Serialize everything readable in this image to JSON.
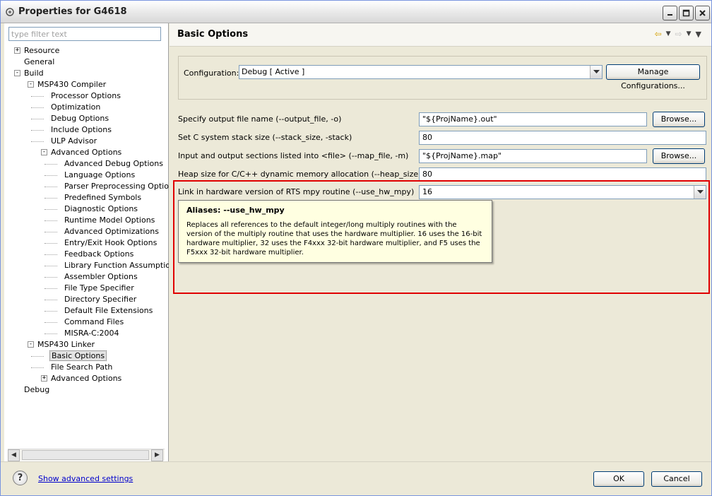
{
  "window": {
    "title": "Properties for G4618"
  },
  "left": {
    "filter_placeholder": "type filter text",
    "tree": [
      {
        "label": "Resource",
        "level": 0,
        "expander": "+"
      },
      {
        "label": "General",
        "level": 0
      },
      {
        "label": "Build",
        "level": 0,
        "expander": "-"
      },
      {
        "label": "MSP430 Compiler",
        "level": 1,
        "expander": "-"
      },
      {
        "label": "Processor Options",
        "level": 2
      },
      {
        "label": "Optimization",
        "level": 2
      },
      {
        "label": "Debug Options",
        "level": 2
      },
      {
        "label": "Include Options",
        "level": 2
      },
      {
        "label": "ULP Advisor",
        "level": 2
      },
      {
        "label": "Advanced Options",
        "level": 2,
        "expander": "-"
      },
      {
        "label": "Advanced Debug Options",
        "level": 3
      },
      {
        "label": "Language Options",
        "level": 3
      },
      {
        "label": "Parser Preprocessing Option",
        "level": 3
      },
      {
        "label": "Predefined Symbols",
        "level": 3
      },
      {
        "label": "Diagnostic Options",
        "level": 3
      },
      {
        "label": "Runtime Model Options",
        "level": 3
      },
      {
        "label": "Advanced Optimizations",
        "level": 3
      },
      {
        "label": "Entry/Exit Hook Options",
        "level": 3
      },
      {
        "label": "Feedback Options",
        "level": 3
      },
      {
        "label": "Library Function Assumption",
        "level": 3
      },
      {
        "label": "Assembler Options",
        "level": 3
      },
      {
        "label": "File Type Specifier",
        "level": 3
      },
      {
        "label": "Directory Specifier",
        "level": 3
      },
      {
        "label": "Default File Extensions",
        "level": 3
      },
      {
        "label": "Command Files",
        "level": 3
      },
      {
        "label": "MISRA-C:2004",
        "level": 3
      },
      {
        "label": "MSP430 Linker",
        "level": 1,
        "expander": "-"
      },
      {
        "label": "Basic Options",
        "level": 2,
        "selected": true
      },
      {
        "label": "File Search Path",
        "level": 2
      },
      {
        "label": "Advanced Options",
        "level": 2,
        "expander": "+"
      },
      {
        "label": "Debug",
        "level": 0
      }
    ]
  },
  "right": {
    "page_title": "Basic Options",
    "config_label": "Configuration:",
    "config_value": "Debug  [ Active ]",
    "manage_button": "Manage Configurations...",
    "rows": [
      {
        "label": "Specify output file name (--output_file, -o)",
        "value": "\"${ProjName}.out\"",
        "browse": "Browse..."
      },
      {
        "label": "Set C system stack size (--stack_size, -stack)",
        "value": "80"
      },
      {
        "label": "Input and output sections listed into <file> (--map_file, -m)",
        "value": "\"${ProjName}.map\"",
        "browse": "Browse..."
      },
      {
        "label": "Heap size for C/C++ dynamic memory allocation (--heap_size, -heap)",
        "value": "80"
      },
      {
        "label": "Link in hardware version of RTS mpy routine (--use_hw_mpy)",
        "value": "16"
      }
    ],
    "tooltip": {
      "title": "Aliases: --use_hw_mpy",
      "body": "Replaces all references to the default integer/long multiply routines with the version of the multiply routine that uses the hardware multiplier.  16 uses the 16-bit hardware multiplier, 32 uses the F4xxx 32-bit hardware multiplier, and F5 uses the F5xxx 32-bit hardware multiplier."
    },
    "highlight_color": "#e00000"
  },
  "bottom": {
    "help_glyph": "?",
    "advanced_link": "Show advanced settings",
    "ok": "OK",
    "cancel": "Cancel"
  }
}
